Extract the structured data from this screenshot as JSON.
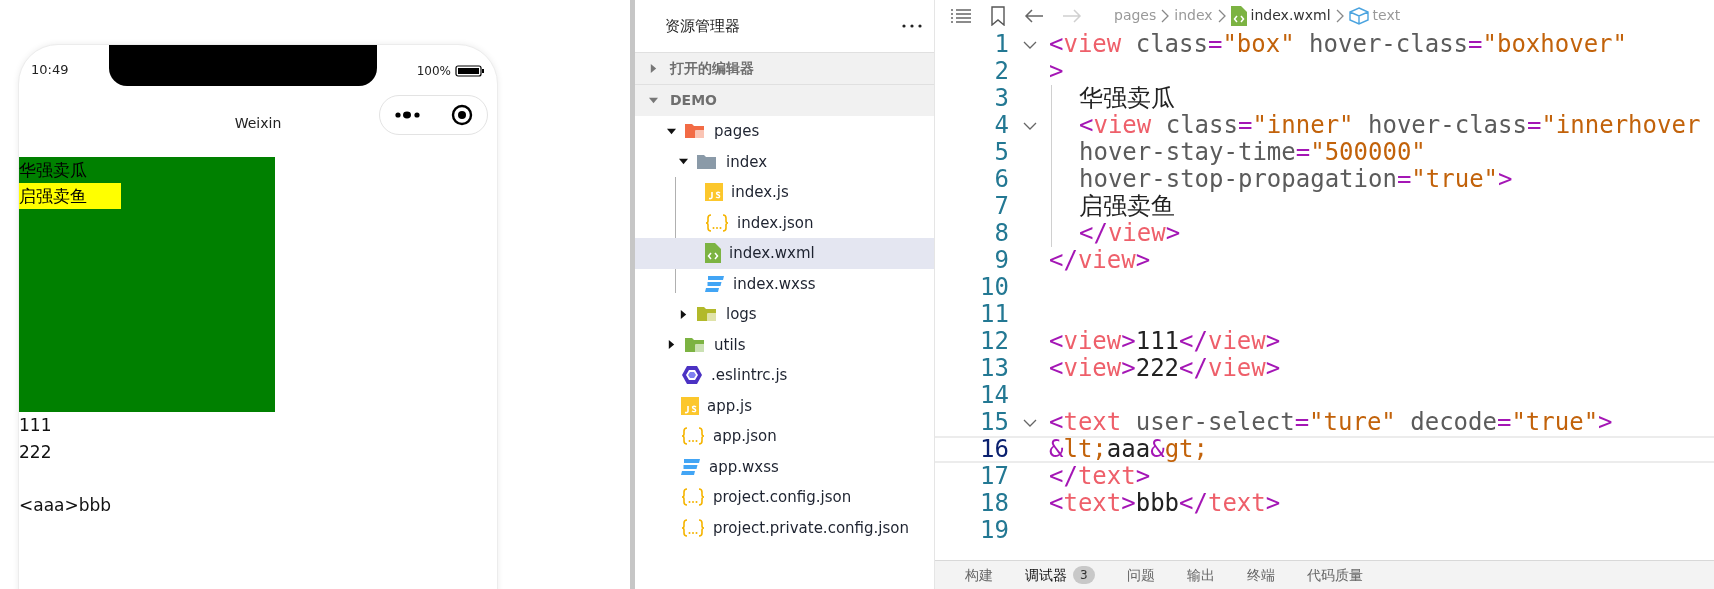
{
  "simulator": {
    "status_bar": {
      "time": "10:49",
      "battery": "100%"
    },
    "nav_title": "Weixin",
    "box": {
      "text": "华强卖瓜",
      "inner": "启强卖鱼"
    },
    "lines": [
      "111",
      "222"
    ],
    "text_line": "<aaa>bbb"
  },
  "explorer": {
    "title": "资源管理器",
    "sections": [
      {
        "label": "打开的编辑器",
        "expanded": false
      },
      {
        "label": "DEMO",
        "expanded": true,
        "children": [
          {
            "label": "pages",
            "kind": "folder_pages",
            "expanded": true,
            "selected": false,
            "children": [
              {
                "label": "index",
                "kind": "folder",
                "expanded": true,
                "selected": false,
                "children": [
                  {
                    "label": "index.js",
                    "kind": "js",
                    "selected": false
                  },
                  {
                    "label": "index.json",
                    "kind": "json",
                    "selected": false
                  },
                  {
                    "label": "index.wxml",
                    "kind": "wxml",
                    "selected": true
                  },
                  {
                    "label": "index.wxss",
                    "kind": "wxss",
                    "selected": false
                  }
                ]
              },
              {
                "label": "logs",
                "kind": "folder_logs",
                "expanded": false,
                "selected": false
              }
            ]
          },
          {
            "label": "utils",
            "kind": "folder_utils",
            "expanded": false,
            "selected": false
          },
          {
            "label": ".eslintrc.js",
            "kind": "eslint",
            "selected": false
          },
          {
            "label": "app.js",
            "kind": "js",
            "selected": false
          },
          {
            "label": "app.json",
            "kind": "json",
            "selected": false
          },
          {
            "label": "app.wxss",
            "kind": "wxss",
            "selected": false
          },
          {
            "label": "project.config.json",
            "kind": "json",
            "selected": false
          },
          {
            "label": "project.private.config.json",
            "kind": "json",
            "selected": false
          }
        ]
      }
    ]
  },
  "editor": {
    "forward_disabled": true,
    "breadcrumb": [
      {
        "label": "pages",
        "kind": "plain"
      },
      {
        "label": "index",
        "kind": "plain"
      },
      {
        "label": "index.wxml",
        "kind": "wxml"
      },
      {
        "label": "text",
        "kind": "element"
      }
    ],
    "lines": [
      {
        "number": "1",
        "foldable": true,
        "indented": false,
        "current": false,
        "tokens": [
          {
            "kind": "bracket",
            "text": "<"
          },
          {
            "kind": "tag",
            "text": "view"
          },
          {
            "kind": "attr",
            "text": " class"
          },
          {
            "kind": "bracket",
            "text": "="
          },
          {
            "kind": "value",
            "text": "\"box\""
          },
          {
            "kind": "attr",
            "text": " hover-class"
          },
          {
            "kind": "bracket",
            "text": "="
          },
          {
            "kind": "value",
            "text": "\"boxhover\""
          }
        ]
      },
      {
        "number": "2",
        "foldable": false,
        "indented": false,
        "current": false,
        "tokens": [
          {
            "kind": "bracket",
            "text": ">"
          }
        ]
      },
      {
        "number": "3",
        "foldable": false,
        "indented": true,
        "current": false,
        "tokens": [
          {
            "kind": "text",
            "text": "华强卖瓜"
          }
        ]
      },
      {
        "number": "4",
        "foldable": true,
        "indented": true,
        "current": false,
        "tokens": [
          {
            "kind": "bracket",
            "text": "<"
          },
          {
            "kind": "tag",
            "text": "view"
          },
          {
            "kind": "attr",
            "text": " class"
          },
          {
            "kind": "bracket",
            "text": "="
          },
          {
            "kind": "value",
            "text": "\"inner\""
          },
          {
            "kind": "attr",
            "text": " hover-class"
          },
          {
            "kind": "bracket",
            "text": "="
          },
          {
            "kind": "value",
            "text": "\"innerhover"
          }
        ]
      },
      {
        "number": "5",
        "foldable": false,
        "indented": true,
        "current": false,
        "tokens": [
          {
            "kind": "attr",
            "text": "hover-stay-time"
          },
          {
            "kind": "bracket",
            "text": "="
          },
          {
            "kind": "value",
            "text": "\"500000\""
          }
        ]
      },
      {
        "number": "6",
        "foldable": false,
        "indented": true,
        "current": false,
        "tokens": [
          {
            "kind": "attr",
            "text": "hover-stop-propagation"
          },
          {
            "kind": "bracket",
            "text": "="
          },
          {
            "kind": "value",
            "text": "\"true\""
          },
          {
            "kind": "bracket",
            "text": ">"
          }
        ]
      },
      {
        "number": "7",
        "foldable": false,
        "indented": true,
        "current": false,
        "tokens": [
          {
            "kind": "text",
            "text": "启强卖鱼"
          }
        ]
      },
      {
        "number": "8",
        "foldable": false,
        "indented": true,
        "current": false,
        "tokens": [
          {
            "kind": "bracket",
            "text": "</"
          },
          {
            "kind": "tag",
            "text": "view"
          },
          {
            "kind": "bracket",
            "text": ">"
          }
        ]
      },
      {
        "number": "9",
        "foldable": false,
        "indented": false,
        "current": false,
        "tokens": [
          {
            "kind": "bracket",
            "text": "</"
          },
          {
            "kind": "tag",
            "text": "view"
          },
          {
            "kind": "bracket",
            "text": ">"
          }
        ]
      },
      {
        "number": "10",
        "foldable": false,
        "indented": false,
        "current": false
      },
      {
        "number": "11",
        "foldable": false,
        "indented": false,
        "current": false
      },
      {
        "number": "12",
        "foldable": false,
        "indented": false,
        "current": false,
        "tokens": [
          {
            "kind": "bracket",
            "text": "<"
          },
          {
            "kind": "tag",
            "text": "view"
          },
          {
            "kind": "bracket",
            "text": ">"
          },
          {
            "kind": "text",
            "text": "111"
          },
          {
            "kind": "bracket",
            "text": "</"
          },
          {
            "kind": "tag",
            "text": "view"
          },
          {
            "kind": "bracket",
            "text": ">"
          }
        ]
      },
      {
        "number": "13",
        "foldable": false,
        "indented": false,
        "current": false,
        "tokens": [
          {
            "kind": "bracket",
            "text": "<"
          },
          {
            "kind": "tag",
            "text": "view"
          },
          {
            "kind": "bracket",
            "text": ">"
          },
          {
            "kind": "text",
            "text": "222"
          },
          {
            "kind": "bracket",
            "text": "</"
          },
          {
            "kind": "tag",
            "text": "view"
          },
          {
            "kind": "bracket",
            "text": ">"
          }
        ]
      },
      {
        "number": "14",
        "foldable": false,
        "indented": false,
        "current": false
      },
      {
        "number": "15",
        "foldable": true,
        "indented": false,
        "current": false,
        "tokens": [
          {
            "kind": "bracket",
            "text": "<"
          },
          {
            "kind": "tag",
            "text": "text"
          },
          {
            "kind": "attr",
            "text": " user-select"
          },
          {
            "kind": "bracket",
            "text": "="
          },
          {
            "kind": "value",
            "text": "\"ture\""
          },
          {
            "kind": "attr",
            "text": " decode"
          },
          {
            "kind": "bracket",
            "text": "="
          },
          {
            "kind": "value",
            "text": "\"true\""
          },
          {
            "kind": "bracket",
            "text": ">"
          }
        ]
      },
      {
        "number": "16",
        "foldable": false,
        "indented": false,
        "current": true,
        "tokens": [
          {
            "kind": "bracket",
            "text": "&"
          },
          {
            "kind": "value",
            "text": "lt;"
          },
          {
            "kind": "text",
            "text": "aaa"
          },
          {
            "kind": "bracket",
            "text": "&"
          },
          {
            "kind": "value",
            "text": "gt;"
          }
        ]
      },
      {
        "number": "17",
        "foldable": false,
        "indented": false,
        "current": false,
        "tokens": [
          {
            "kind": "bracket",
            "text": "</"
          },
          {
            "kind": "tag",
            "text": "text"
          },
          {
            "kind": "bracket",
            "text": ">"
          }
        ]
      },
      {
        "number": "18",
        "foldable": false,
        "indented": false,
        "current": false,
        "tokens": [
          {
            "kind": "bracket",
            "text": "<"
          },
          {
            "kind": "tag",
            "text": "text"
          },
          {
            "kind": "bracket",
            "text": ">"
          },
          {
            "kind": "text",
            "text": "bbb"
          },
          {
            "kind": "bracket",
            "text": "</"
          },
          {
            "kind": "tag",
            "text": "text"
          },
          {
            "kind": "bracket",
            "text": ">"
          }
        ]
      },
      {
        "number": "19",
        "foldable": false,
        "indented": false,
        "current": false
      }
    ]
  },
  "panel_tabs": [
    {
      "label": "构建",
      "selected": false
    },
    {
      "label": "调试器",
      "selected": true,
      "badge": "3"
    },
    {
      "label": "问题",
      "selected": false
    },
    {
      "label": "输出",
      "selected": false
    },
    {
      "label": "终端",
      "selected": false
    },
    {
      "label": "代码质量",
      "selected": false
    }
  ]
}
